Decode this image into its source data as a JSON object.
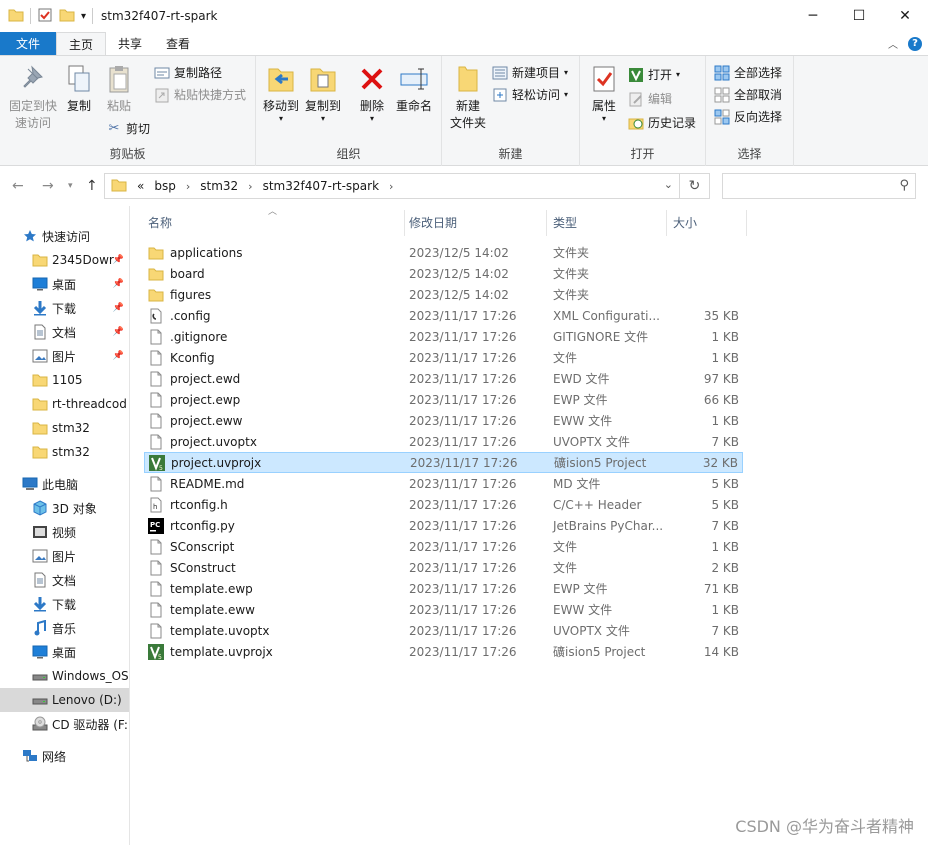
{
  "window": {
    "title": "stm32f407-rt-spark"
  },
  "tabs": {
    "file": "文件",
    "home": "主页",
    "share": "共享",
    "view": "查看"
  },
  "ribbon": {
    "clipboard": {
      "label": "剪贴板",
      "pin": "固定到快速访问",
      "copy": "复制",
      "paste": "粘贴",
      "copy_path": "复制路径",
      "paste_shortcut": "粘贴快捷方式",
      "cut": "剪切"
    },
    "organize": {
      "label": "组织",
      "move_to": "移动到",
      "copy_to": "复制到",
      "delete": "删除",
      "rename": "重命名"
    },
    "new": {
      "label": "新建",
      "new_folder": "新建\n文件夹",
      "new_item": "新建项目",
      "easy_access": "轻松访问"
    },
    "open": {
      "label": "打开",
      "properties": "属性",
      "open": "打开",
      "edit": "编辑",
      "history": "历史记录"
    },
    "select": {
      "label": "选择",
      "select_all": "全部选择",
      "select_none": "全部取消",
      "invert": "反向选择"
    }
  },
  "address": {
    "prefix": "«",
    "crumbs": [
      "bsp",
      "stm32",
      "stm32f407-rt-spark"
    ]
  },
  "nav": {
    "items": [
      {
        "label": "快速访问",
        "icon": "star-icon",
        "level": 0
      },
      {
        "label": "2345Dowr",
        "icon": "folder-icon",
        "level": 1,
        "pinned": true
      },
      {
        "label": "桌面",
        "icon": "desktop-icon",
        "level": 1,
        "pinned": true
      },
      {
        "label": "下载",
        "icon": "download-icon",
        "level": 1,
        "pinned": true
      },
      {
        "label": "文档",
        "icon": "document-icon",
        "level": 1,
        "pinned": true
      },
      {
        "label": "图片",
        "icon": "pictures-icon",
        "level": 1,
        "pinned": true
      },
      {
        "label": "1105",
        "icon": "folder-icon",
        "level": 1
      },
      {
        "label": "rt-threadcod",
        "icon": "folder-icon",
        "level": 1
      },
      {
        "label": "stm32",
        "icon": "folder-icon",
        "level": 1
      },
      {
        "label": "stm32",
        "icon": "folder-icon",
        "level": 1
      },
      {
        "label": "此电脑",
        "icon": "computer-icon",
        "level": 0
      },
      {
        "label": "3D 对象",
        "icon": "3d-objects-icon",
        "level": 1
      },
      {
        "label": "视频",
        "icon": "video-icon",
        "level": 1
      },
      {
        "label": "图片",
        "icon": "pictures-icon",
        "level": 1
      },
      {
        "label": "文档",
        "icon": "document-icon",
        "level": 1
      },
      {
        "label": "下载",
        "icon": "download-icon",
        "level": 1
      },
      {
        "label": "音乐",
        "icon": "music-icon",
        "level": 1
      },
      {
        "label": "桌面",
        "icon": "desktop-icon",
        "level": 1
      },
      {
        "label": "Windows_OS",
        "icon": "drive-icon",
        "level": 1
      },
      {
        "label": "Lenovo (D:)",
        "icon": "drive-icon",
        "level": 1,
        "selected": true
      },
      {
        "label": "CD 驱动器 (F:",
        "icon": "cd-drive-icon",
        "level": 1
      },
      {
        "label": "网络",
        "icon": "network-icon",
        "level": 0
      }
    ]
  },
  "list": {
    "columns": [
      "名称",
      "修改日期",
      "类型",
      "大小"
    ],
    "rows": [
      {
        "name": "applications",
        "date": "2023/12/5 14:02",
        "type": "文件夹",
        "size": "",
        "icon": "folder-icon"
      },
      {
        "name": "board",
        "date": "2023/12/5 14:02",
        "type": "文件夹",
        "size": "",
        "icon": "folder-icon"
      },
      {
        "name": "figures",
        "date": "2023/12/5 14:02",
        "type": "文件夹",
        "size": "",
        "icon": "folder-icon"
      },
      {
        "name": ".config",
        "date": "2023/11/17 17:26",
        "type": "XML Configurati...",
        "size": "35 KB",
        "icon": "xml-config-icon"
      },
      {
        "name": ".gitignore",
        "date": "2023/11/17 17:26",
        "type": "GITIGNORE 文件",
        "size": "1 KB",
        "icon": "file-icon"
      },
      {
        "name": "Kconfig",
        "date": "2023/11/17 17:26",
        "type": "文件",
        "size": "1 KB",
        "icon": "file-icon"
      },
      {
        "name": "project.ewd",
        "date": "2023/11/17 17:26",
        "type": "EWD 文件",
        "size": "97 KB",
        "icon": "file-icon"
      },
      {
        "name": "project.ewp",
        "date": "2023/11/17 17:26",
        "type": "EWP 文件",
        "size": "66 KB",
        "icon": "file-icon"
      },
      {
        "name": "project.eww",
        "date": "2023/11/17 17:26",
        "type": "EWW 文件",
        "size": "1 KB",
        "icon": "file-icon"
      },
      {
        "name": "project.uvoptx",
        "date": "2023/11/17 17:26",
        "type": "UVOPTX 文件",
        "size": "7 KB",
        "icon": "file-icon"
      },
      {
        "name": "project.uvprojx",
        "date": "2023/11/17 17:26",
        "type": "礦ision5 Project",
        "size": "32 KB",
        "icon": "keil-icon",
        "selected": true
      },
      {
        "name": "README.md",
        "date": "2023/11/17 17:26",
        "type": "MD 文件",
        "size": "5 KB",
        "icon": "file-icon"
      },
      {
        "name": "rtconfig.h",
        "date": "2023/11/17 17:26",
        "type": "C/C++ Header",
        "size": "5 KB",
        "icon": "header-file-icon"
      },
      {
        "name": "rtconfig.py",
        "date": "2023/11/17 17:26",
        "type": "JetBrains PyChar...",
        "size": "7 KB",
        "icon": "pycharm-icon"
      },
      {
        "name": "SConscript",
        "date": "2023/11/17 17:26",
        "type": "文件",
        "size": "1 KB",
        "icon": "file-icon"
      },
      {
        "name": "SConstruct",
        "date": "2023/11/17 17:26",
        "type": "文件",
        "size": "2 KB",
        "icon": "file-icon"
      },
      {
        "name": "template.ewp",
        "date": "2023/11/17 17:26",
        "type": "EWP 文件",
        "size": "71 KB",
        "icon": "file-icon"
      },
      {
        "name": "template.eww",
        "date": "2023/11/17 17:26",
        "type": "EWW 文件",
        "size": "1 KB",
        "icon": "file-icon"
      },
      {
        "name": "template.uvoptx",
        "date": "2023/11/17 17:26",
        "type": "UVOPTX 文件",
        "size": "7 KB",
        "icon": "file-icon"
      },
      {
        "name": "template.uvprojx",
        "date": "2023/11/17 17:26",
        "type": "礦ision5 Project",
        "size": "14 KB",
        "icon": "keil-icon"
      }
    ]
  },
  "watermark": "CSDN @华为奋斗者精神",
  "colors": {
    "accent": "#1979ca",
    "selection": "#cce8ff",
    "folder": "#f8d775"
  }
}
